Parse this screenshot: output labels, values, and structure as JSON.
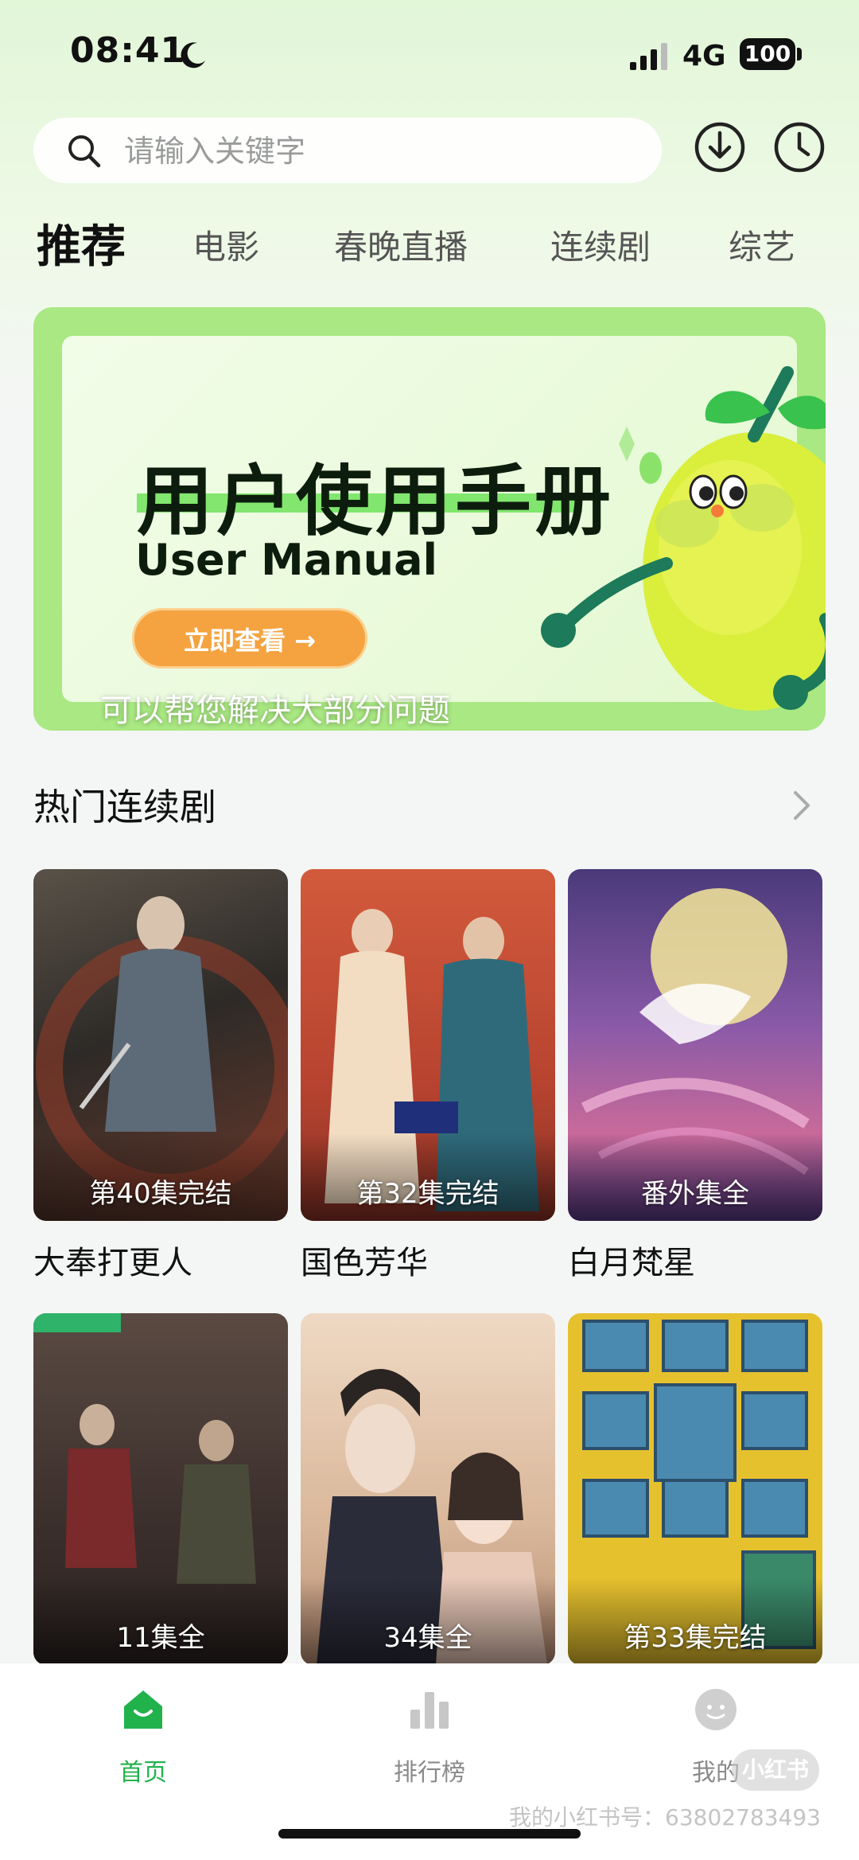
{
  "status_bar": {
    "time": "08:41",
    "network": "4G",
    "battery": "100"
  },
  "search": {
    "placeholder": "请输入关键字"
  },
  "tabs": [
    {
      "label": "推荐",
      "active": true
    },
    {
      "label": "电影"
    },
    {
      "label": "春晚直播"
    },
    {
      "label": "连续剧"
    },
    {
      "label": "综艺"
    }
  ],
  "banner": {
    "title": "用户使用手册",
    "subtitle": "User Manual",
    "button": "立即查看 →",
    "caption": "可以帮您解决大部分问题"
  },
  "section": {
    "title": "热门连续剧"
  },
  "shows": [
    {
      "title": "大奉打更人",
      "episode": "第40集完结",
      "color": "#3a3530"
    },
    {
      "title": "国色芳华",
      "episode": "第32集完结",
      "color": "#c44a32"
    },
    {
      "title": "白月梵星",
      "episode": "番外集全",
      "color": "#7a4c9e"
    },
    {
      "title": "",
      "episode": "11集全",
      "color": "#3b2f2c"
    },
    {
      "title": "",
      "episode": "34集全",
      "color": "#d9b79a"
    },
    {
      "title": "",
      "episode": "第33集完结",
      "color": "#e6c12e"
    }
  ],
  "bottom_nav": [
    {
      "label": "首页",
      "icon": "home-icon",
      "active": true
    },
    {
      "label": "排行榜",
      "icon": "ranking-icon"
    },
    {
      "label": "我的",
      "icon": "profile-icon"
    }
  ],
  "watermark": {
    "logo": "小红书",
    "text": "我的小红书号：63802783493"
  },
  "colors": {
    "accent": "#22b24c",
    "banner_green": "#a9e882",
    "button_orange": "#f4a340"
  }
}
